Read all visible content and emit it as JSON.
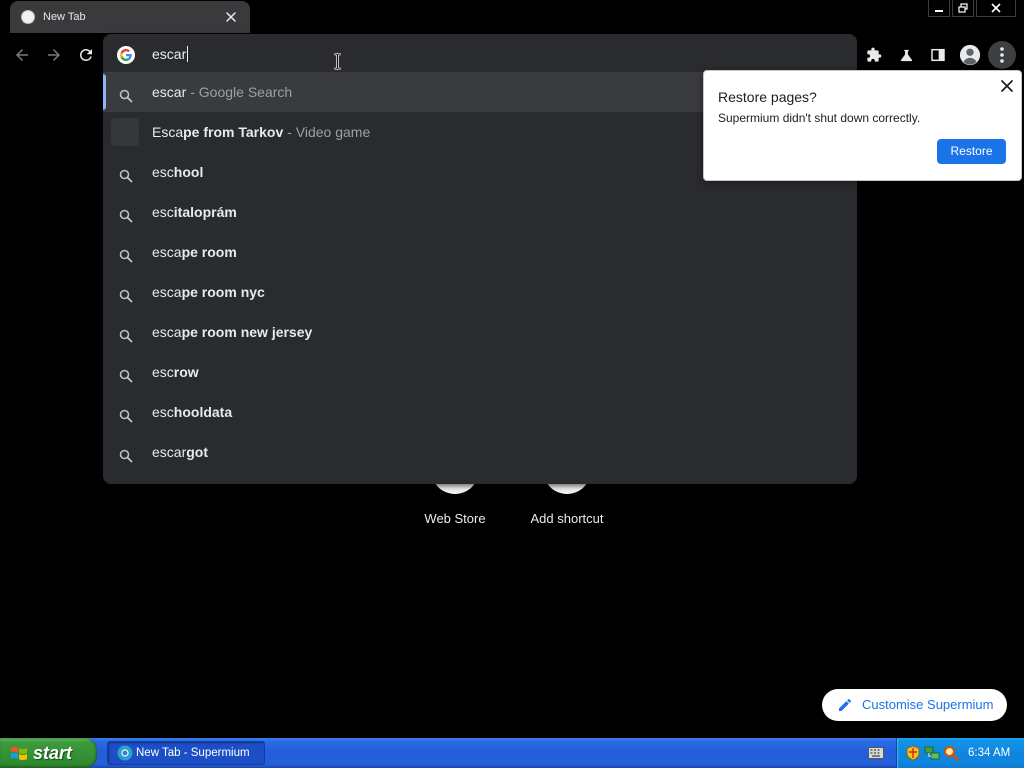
{
  "browser": {
    "tab": {
      "title": "New Tab",
      "favicon": "globe-icon",
      "close_icon": "close-icon"
    },
    "window_controls": [
      "minimize-icon",
      "restore-icon",
      "close-icon"
    ],
    "nav": {
      "back_icon": "arrow-left-icon",
      "forward_icon": "arrow-right-icon",
      "reload_icon": "reload-icon",
      "back_enabled": false,
      "forward_enabled": false
    },
    "omnibox": {
      "value": "escar",
      "provider_icon": "google-g-icon"
    },
    "toolbar_icons": [
      "puzzle-icon",
      "flask-icon",
      "side-panel-icon",
      "profile-avatar-icon",
      "kebab-menu-icon"
    ]
  },
  "suggestions": [
    {
      "icon": "search-icon",
      "match": "escar",
      "description": "- Google Search",
      "selected": true
    },
    {
      "icon": "entity-thumbnail",
      "match": "Esca",
      "completion": "pe from Tarkov",
      "description": "- Video game"
    },
    {
      "icon": "search-icon",
      "match": "esc",
      "completion": "hool"
    },
    {
      "icon": "search-icon",
      "match": "esc",
      "completion": "italoprám"
    },
    {
      "icon": "search-icon",
      "match": "esca",
      "completion": "pe room"
    },
    {
      "icon": "search-icon",
      "match": "esca",
      "completion": "pe room nyc"
    },
    {
      "icon": "search-icon",
      "match": "esca",
      "completion": "pe room new jersey"
    },
    {
      "icon": "search-icon",
      "match": "esc",
      "completion": "row"
    },
    {
      "icon": "search-icon",
      "match": "esc",
      "completion": "hooldata"
    },
    {
      "icon": "search-icon",
      "match": "escar",
      "completion": "got"
    }
  ],
  "new_tab_page": {
    "shortcuts": [
      {
        "label": "Web Store"
      },
      {
        "label": "Add shortcut"
      }
    ],
    "customise_label": "Customise Supermium",
    "customise_icon": "pencil-icon"
  },
  "restore_bubble": {
    "title": "Restore pages?",
    "message": "Supermium didn't shut down correctly.",
    "button_label": "Restore",
    "close_icon": "close-icon"
  },
  "taskbar": {
    "start_label": "start",
    "tasks": [
      {
        "label": "New Tab - Supermium",
        "icon": "supermium-icon",
        "active": true
      }
    ],
    "tray_icons": [
      "keyboard-icon",
      "security-shield-icon",
      "network-icon",
      "search-icon"
    ],
    "clock": "6:34 AM"
  },
  "colors": {
    "accent": "#1a73e8",
    "selection_bar": "#8ab4f8",
    "popup_background": "#2a2b2e",
    "taskbar_blue": "#245edc",
    "start_green": "#3c9a3c"
  }
}
